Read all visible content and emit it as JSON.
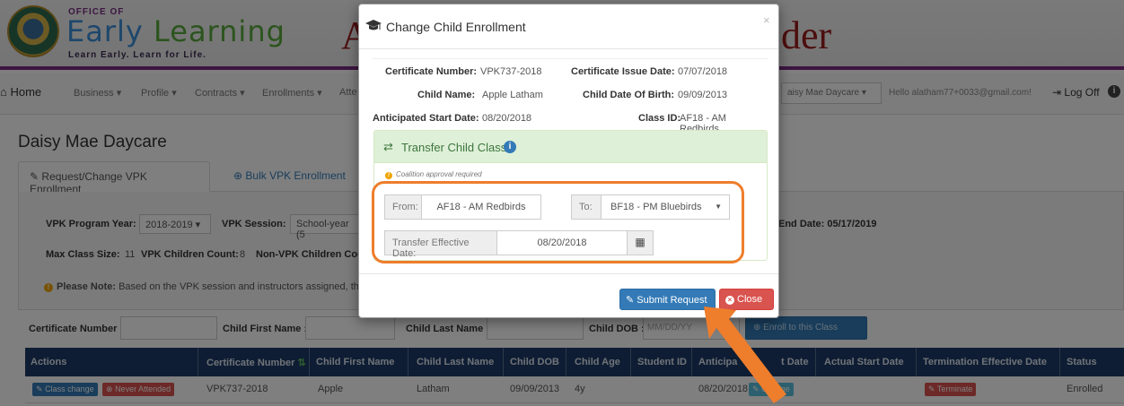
{
  "banner": {
    "office_of": "OFFICE OF",
    "logo_early": "Early ",
    "logo_learning": "Learning",
    "tagline": "Learn Early. Learn for Life.",
    "title_left": "A",
    "title_right": "der"
  },
  "navbar": {
    "home": "Home",
    "items": [
      "Business ▾",
      "Profile ▾",
      "Contracts ▾",
      "Enrollments ▾",
      "Atte"
    ],
    "provider_select": "aisy Mae Daycare",
    "hello": "Hello alatham77+0033@gmail.com!",
    "logoff": "Log Off"
  },
  "page": {
    "heading": "Daisy Mae Daycare",
    "tabs": [
      "Request/Change VPK Enrollment",
      "Bulk VPK Enrollment"
    ],
    "program_year_label": "VPK Program Year:",
    "program_year_value": "2018-2019",
    "session_label": "VPK Session:",
    "session_value": "School-year (5",
    "end_date": "End Date: 05/17/2019",
    "max_class_label": "Max Class Size:",
    "max_class_value": "11",
    "vpk_count_label": "VPK Children Count:",
    "vpk_count_value": "8",
    "non_vpk_label": "Non-VPK Children Cou",
    "note_bold": "Please Note:",
    "note_text": " Based on the VPK session and instructors assigned, the ma"
  },
  "filters": {
    "cert_label": "Certificate Number :",
    "first_label": "Child First Name :",
    "last_label": "Child Last Name :",
    "dob_label": "Child DOB :",
    "dob_placeholder": "MM/DD/YY",
    "enroll_button": "Enroll to this Class"
  },
  "table": {
    "headers": [
      "Actions",
      "Certificate Number",
      "Child First Name",
      "Child Last Name",
      "Child DOB",
      "Child Age",
      "Student ID",
      "Anticipa",
      "t Date",
      "Actual Start Date",
      "Termination Effective Date",
      "Status"
    ],
    "row": {
      "class_change": "Class change",
      "never_attended": "Never Attended",
      "certificate": "VPK737-2018",
      "first": "Apple",
      "last": "Latham",
      "dob": "09/09/2013",
      "age": "4y",
      "start": "08/20/2018",
      "change": "Change",
      "terminate": "Terminate",
      "status": "Enrolled"
    }
  },
  "modal": {
    "title": "Change Child Enrollment",
    "close_x": "×",
    "cert_label": "Certificate Number:",
    "cert_value": "VPK737-2018",
    "issue_label": "Certificate Issue Date:",
    "issue_value": "07/07/2018",
    "child_label": "Child Name:",
    "child_value": "Apple Latham",
    "dob_label": "Child Date Of Birth:",
    "dob_value": "09/09/2013",
    "start_label": "Anticipated Start Date:",
    "start_value": "08/20/2018",
    "class_label": "Class ID:",
    "class_value": "AF18 - AM Redbirds",
    "transfer_title": "Transfer Child Class",
    "coalition_note": "Coalition approval required",
    "from_label": "From:",
    "from_value": "AF18 - AM Redbirds",
    "to_label": "To:",
    "to_value": "BF18 - PM Bluebirds",
    "effective_label": "Transfer Effective Date:",
    "effective_value": "08/20/2018",
    "submit": "Submit Request",
    "close": "Close"
  },
  "colors": {
    "primary": "#337ab7",
    "danger": "#d9534f",
    "success_bg": "#dff0d8",
    "highlight": "#ee7d2c",
    "table_header": "#1d3a66"
  }
}
